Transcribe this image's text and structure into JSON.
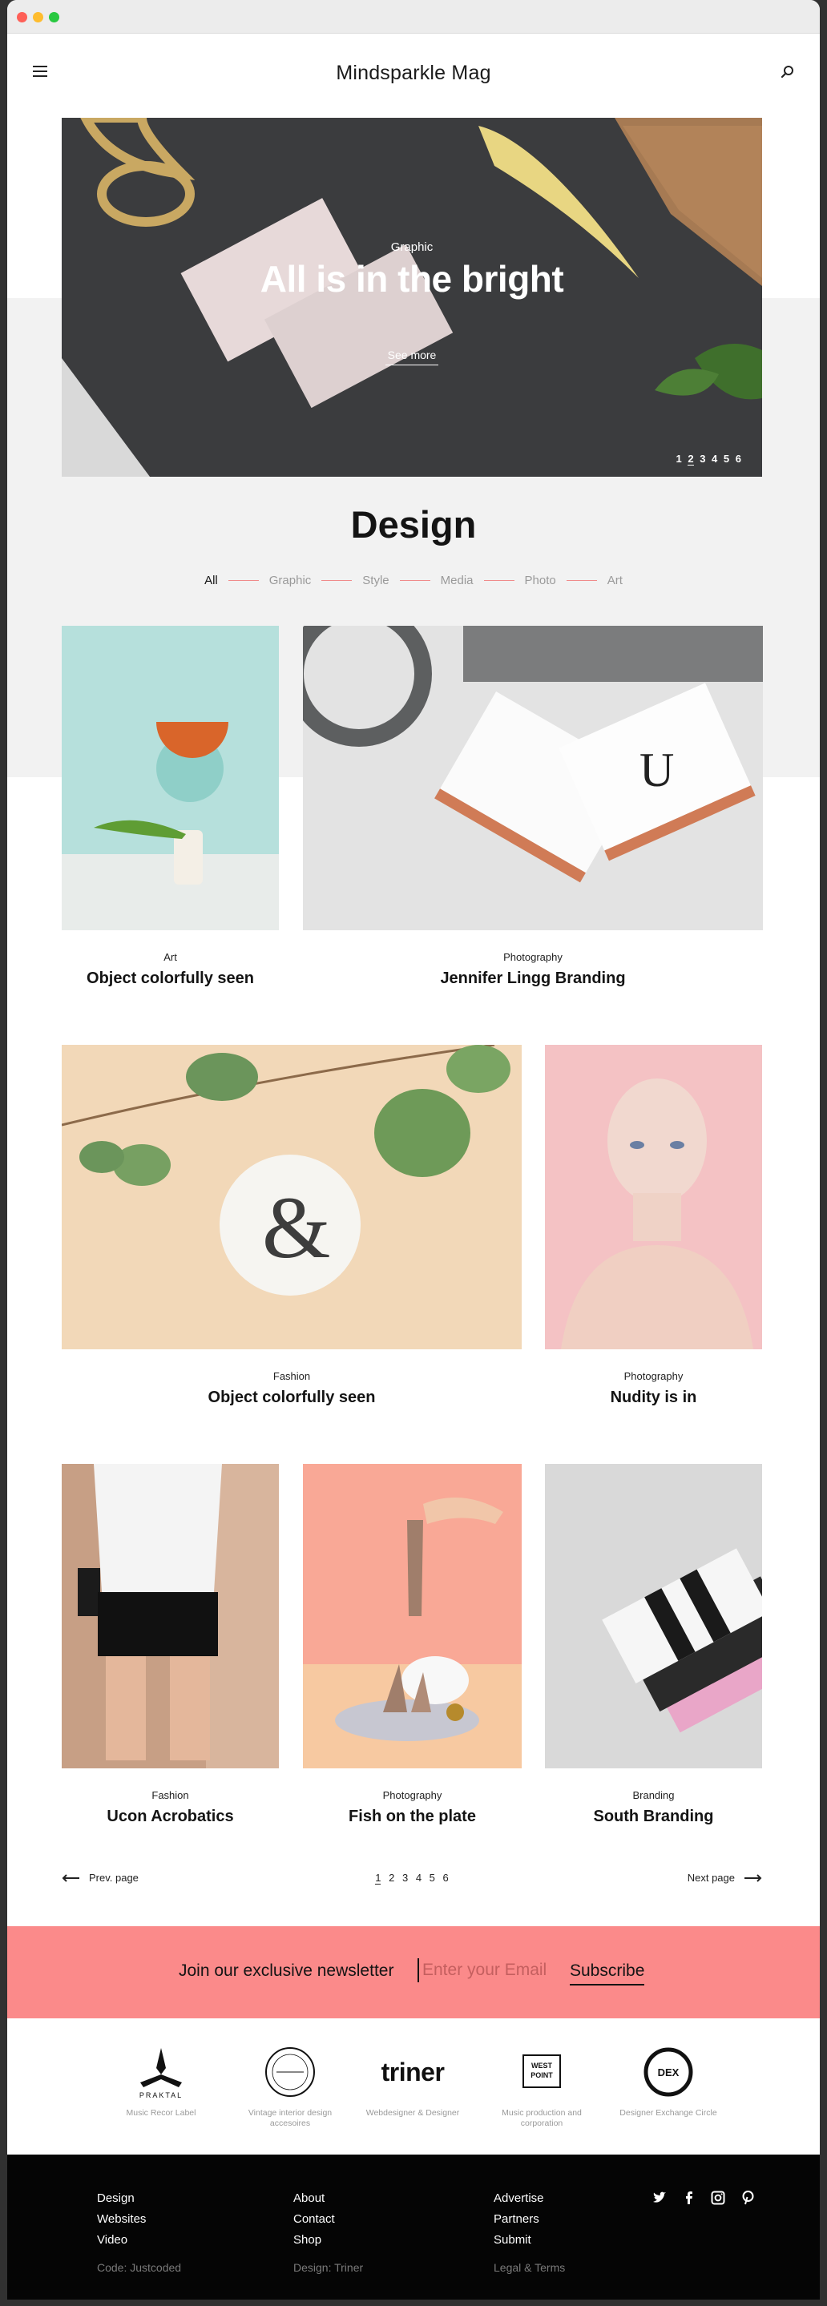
{
  "window": {
    "controls": [
      {
        "name": "close",
        "color": "#fe5f57"
      },
      {
        "name": "minimize",
        "color": "#febc2e"
      },
      {
        "name": "zoom",
        "color": "#28c840"
      }
    ]
  },
  "header": {
    "brand": "Mindsparkle Mag",
    "menu_icon": "hamburger-icon",
    "search_icon": "search-icon"
  },
  "hero": {
    "category": "Graphic",
    "title": "All is in the bright",
    "cta": "See more",
    "pages": [
      "1",
      "2",
      "3",
      "4",
      "5",
      "6"
    ],
    "active_page": "2"
  },
  "section": {
    "title": "Design",
    "filters": [
      "All",
      "Graphic",
      "Style",
      "Media",
      "Photo",
      "Art"
    ],
    "active_filter": "All"
  },
  "posts": [
    {
      "category": "Art",
      "title": "Object colorfully seen"
    },
    {
      "category": "Photography",
      "title": "Jennifer Lingg Branding"
    },
    {
      "category": "Fashion",
      "title": "Object colorfully seen"
    },
    {
      "category": "Photography",
      "title": "Nudity is in"
    },
    {
      "category": "Fashion",
      "title": "Ucon Acrobatics"
    },
    {
      "category": "Photography",
      "title": "Fish on the plate"
    },
    {
      "category": "Branding",
      "title": "South Branding"
    }
  ],
  "pagination": {
    "prev": "Prev. page",
    "next": "Next page",
    "pages": [
      "1",
      "2",
      "3",
      "4",
      "5",
      "6"
    ],
    "active": "1"
  },
  "newsletter": {
    "text": "Join our exclusive newsletter",
    "placeholder": "Enter your Email",
    "button": "Subscribe"
  },
  "partners": [
    {
      "name": "PRAKTAL",
      "caption": "Music Recor Label"
    },
    {
      "name": "Vintage",
      "caption": "Vintage interior design accesoires"
    },
    {
      "name": "triner",
      "caption": "Webdesigner & Designer"
    },
    {
      "name": "WEST POINT",
      "caption": "Music production and corporation"
    },
    {
      "name": "DEX",
      "caption": "Designer Exchange Circle"
    }
  ],
  "footer": {
    "col1": [
      "Design",
      "Websites",
      "Video"
    ],
    "col2": [
      "About",
      "Contact",
      "Shop"
    ],
    "col3": [
      "Advertise",
      "Partners",
      "Submit"
    ],
    "credit1": "Code: Justcoded",
    "credit2": "Design: Triner",
    "credit3": "Legal & Terms",
    "social": [
      "twitter-icon",
      "facebook-icon",
      "instagram-icon",
      "pinterest-icon"
    ]
  },
  "colors": {
    "accent": "#fb8a8a",
    "footer_bg": "#050505",
    "band_bg": "#f2f2f2"
  }
}
